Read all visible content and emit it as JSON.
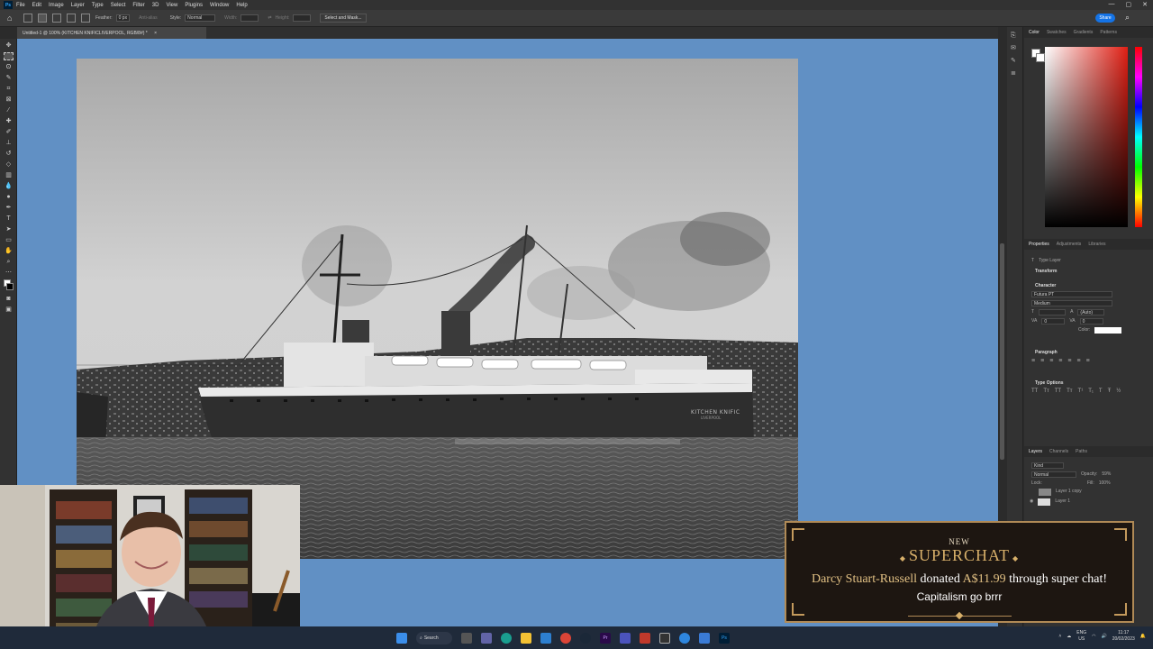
{
  "app": {
    "menu": [
      "File",
      "Edit",
      "Image",
      "Layer",
      "Type",
      "Select",
      "Filter",
      "3D",
      "View",
      "Plugins",
      "Window",
      "Help"
    ],
    "ps_logo": "Ps",
    "window_controls": [
      "—",
      "▢",
      "✕"
    ]
  },
  "options_bar": {
    "feather_label": "Feather:",
    "feather_value": "0 px",
    "antialias_label": "Anti-alias",
    "style_label": "Style:",
    "style_value": "Normal",
    "width_label": "Width:",
    "height_label": "Height:",
    "select_mask_label": "Select and Mask...",
    "share_label": "Share"
  },
  "document": {
    "tab_title": "Untitled-1 @ 100% (KITCHEN KNIFICLIVERPOOL, RGB/8#) *",
    "tab_close": "×"
  },
  "photo": {
    "ship_name_text": "KITCHEN KNIFIC",
    "ship_port_text": "LIVERPOOL"
  },
  "color_panel": {
    "tabs": [
      "Color",
      "Swatches",
      "Gradients",
      "Patterns"
    ],
    "active_tab": "Color"
  },
  "properties_panel": {
    "tabs": [
      "Properties",
      "Adjustments",
      "Libraries"
    ],
    "layer_type": "Type Layer",
    "transform_label": "Transform",
    "character_label": "Character",
    "font_family": "Futura PT",
    "font_style": "Medium",
    "leading": "(Auto)",
    "tracking": "0",
    "kerning": "0",
    "color_label": "Color:",
    "paragraph_label": "Paragraph",
    "type_options_label": "Type Options"
  },
  "layers_panel": {
    "tabs": [
      "Layers",
      "Channels",
      "Paths"
    ],
    "kind_label": "Kind",
    "blend_mode": "Normal",
    "opacity_label": "Opacity:",
    "opacity_value": "59%",
    "lock_label": "Lock:",
    "fill_label": "Fill:",
    "fill_value": "100%",
    "layers": [
      "Layer 1 copy",
      "Layer 1"
    ]
  },
  "superchat": {
    "new_label": "NEW",
    "title": "SUPERCHAT",
    "donor": "Darcy Stuart-Russell",
    "donated_word": "donated",
    "amount": "A$11.99",
    "through_text": "through super chat!",
    "comment": "Capitalism go brrr"
  },
  "taskbar": {
    "search_label": "Search",
    "language": "ENG",
    "region": "US",
    "time": "11:17",
    "date": "20/02/2023"
  },
  "colors": {
    "canvas_bg": "#6190c4",
    "ps_accent": "#31a8ff",
    "superchat_gold": "#d8b06a",
    "taskbar_bg": "#1f2a3a"
  }
}
